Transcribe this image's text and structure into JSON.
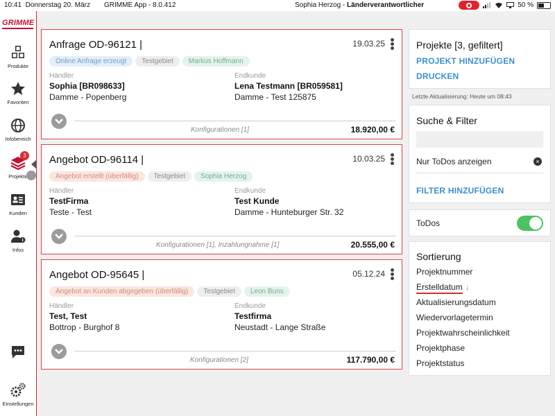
{
  "statusbar": {
    "time": "10:41",
    "date": "Donnerstag 20. März",
    "app": "GRIMME App - 8.0.412",
    "user_name": "Sophia Herzog - ",
    "user_role": "Länderverantwortlicher",
    "battery": "50 %"
  },
  "sidebar": {
    "logo": "GRIMME",
    "items": [
      {
        "label": "Produkte",
        "icon": "cubes-icon"
      },
      {
        "label": "Favoriten",
        "icon": "star-icon"
      },
      {
        "label": "Infobereich",
        "icon": "globe-icon"
      },
      {
        "label": "Projekte",
        "icon": "layers-icon",
        "badge": "3"
      },
      {
        "label": "Kunden",
        "icon": "id-card-icon"
      },
      {
        "label": "Infos",
        "icon": "user-info-icon"
      },
      {
        "label": "",
        "icon": "chat-icon"
      },
      {
        "label": "Einstellungen",
        "icon": "gears-icon"
      }
    ]
  },
  "projects": [
    {
      "title": "Anfrage OD-96121 |",
      "date": "19.03.25",
      "tags": [
        {
          "text": "Online Anfrage erzeugt",
          "color": "blue"
        },
        {
          "text": "Testgebiet",
          "color": "gray"
        },
        {
          "text": "Markus Hoffmann",
          "color": "green"
        }
      ],
      "haendler_label": "Händler",
      "haendler_name": "Sophia [BR098633]",
      "haendler_addr": "Damme - Popenberg",
      "endkunde_label": "Endkunde",
      "endkunde_name": "Lena Testmann [BR059581]",
      "endkunde_addr": "Damme - Test 125875",
      "konfig": "Konfigurationen [1]",
      "price": "18.920,00 €"
    },
    {
      "title": "Angebot OD-96114 |",
      "date": "10.03.25",
      "tags": [
        {
          "text": "Angebot erstellt (überfällig)",
          "color": "red"
        },
        {
          "text": "Testgebiet",
          "color": "gray"
        },
        {
          "text": "Sophia Herzog",
          "color": "green"
        }
      ],
      "haendler_label": "Händler",
      "haendler_name": "TestFirma",
      "haendler_addr": "Teste - Test",
      "endkunde_label": "Endkunde",
      "endkunde_name": "Test Kunde",
      "endkunde_addr": "Damme - Hunteburger Str. 32",
      "konfig": "Konfigurationen [1], Inzahlungnahme [1]",
      "price": "20.555,00 €"
    },
    {
      "title": "Angebot OD-95645 |",
      "date": "05.12.24",
      "tags": [
        {
          "text": "Angebot an Kunden abgegeben (überfällig)",
          "color": "red"
        },
        {
          "text": "Testgebiet",
          "color": "gray"
        },
        {
          "text": "Leon Buns",
          "color": "green"
        }
      ],
      "haendler_label": "Händler",
      "haendler_name": "Test, Test",
      "haendler_addr": "Bottrop - Burghof 8",
      "endkunde_label": "Endkunde",
      "endkunde_name": "Testfirma",
      "endkunde_addr": "Neustadt - Lange Straße",
      "konfig": "Konfigurationen [2]",
      "price": "117.790,00 €"
    }
  ],
  "right": {
    "projects_title": "Projekte [3, gefiltert]",
    "add_project": "PROJEKT HINZUFÜGEN",
    "print": "DRUCKEN",
    "last_update": "Letzte Aktualisierung: Heute um 08:43",
    "search_title": "Suche & Filter",
    "todo_filter": "Nur ToDos anzeigen",
    "add_filter": "FILTER HINZUFÜGEN",
    "todos_label": "ToDos",
    "todos_on": true,
    "sort_title": "Sortierung",
    "sort_items": [
      "Projektnummer",
      "Erstelldatum",
      "Aktualisierungsdatum",
      "Wiedervorlagetermin",
      "Projektwahrscheinlichkeit",
      "Projektphase",
      "Projektstatus"
    ],
    "sort_active": "Erstelldatum",
    "sort_arrow": "↓"
  },
  "colors": {
    "brand_red": "#c8102e",
    "link_blue": "#3d8ed0",
    "toggle_green": "#4cc262"
  }
}
